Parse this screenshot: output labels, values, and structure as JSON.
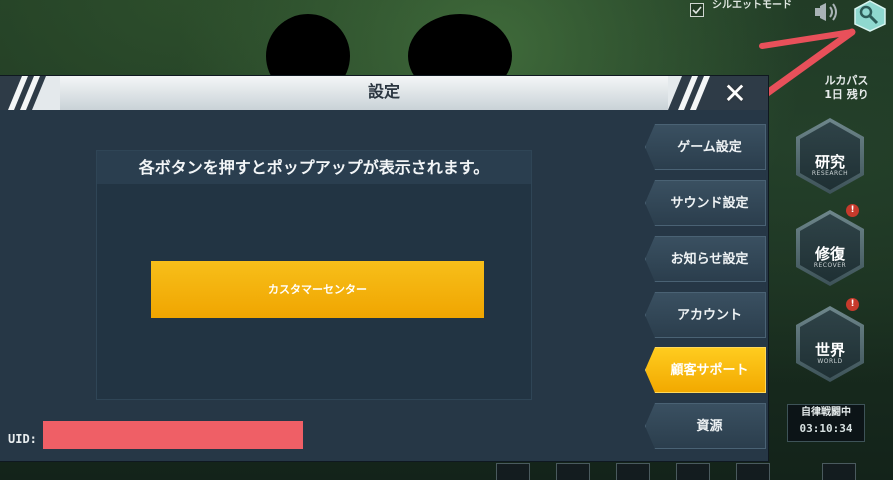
{
  "hud": {
    "silhouette_mode_label": "シルエットモード",
    "pass_label_line1": "ルカパス",
    "pass_label_line2": "1日 残り",
    "menu": [
      {
        "label": "研究",
        "sub": "RESEARCH"
      },
      {
        "label": "修復",
        "sub": "RECOVER"
      },
      {
        "label": "世界",
        "sub": "WORLD"
      }
    ],
    "alert_mark": "!",
    "auto_battle_label": "自律戦闘中",
    "auto_battle_timer": "03:10:34"
  },
  "modal": {
    "title": "設定",
    "close_symbol": "✕",
    "content_header": "各ボタンを押すとポップアップが表示されます。",
    "customer_center_label": "カスタマーセンター",
    "tabs": [
      {
        "label": "ゲーム設定",
        "active": false
      },
      {
        "label": "サウンド設定",
        "active": false
      },
      {
        "label": "お知らせ設定",
        "active": false
      },
      {
        "label": "アカウント",
        "active": false
      },
      {
        "label": "顧客サポート",
        "active": true
      },
      {
        "label": "資源",
        "active": false
      }
    ],
    "uid_label": "UID:"
  },
  "colors": {
    "accent_yellow": "#f2a900",
    "panel_bg": "#263746",
    "redaction": "#ef5f66",
    "arrow": "#e8505a"
  },
  "icons": [
    "checkbox-icon",
    "sound-icon",
    "settings-gear-icon",
    "close-icon",
    "alert-icon"
  ]
}
